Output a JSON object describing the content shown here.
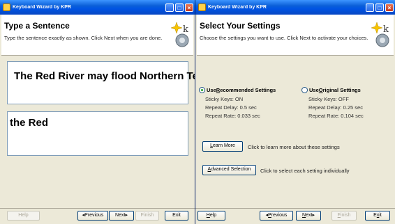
{
  "left": {
    "title": "Keyboard Wizard by KPR",
    "heading": "Type a Sentence",
    "subheading": "Type the sentence exactly as shown. Click Next when you are done.",
    "target_sentence": "The Red River may flood Northern Texas!",
    "typed_text": "the Red",
    "buttons": {
      "help": "Help",
      "previous": "Previous",
      "next": "Next",
      "finish": "Finish",
      "exit": "Exit"
    }
  },
  "right": {
    "title": "Keyboard Wizard by KPR",
    "heading": "Select Your Settings",
    "subheading": "Choose the settings you want to use. Click Next to activate your choices.",
    "options": [
      {
        "label_u": "R",
        "label_rest": "ecommended Settings",
        "prefix": "Use ",
        "selected": true,
        "settings": [
          "Sticky Keys: ON",
          "Repeat Delay: 0.5 sec",
          "Repeat Rate: 0.033 sec"
        ]
      },
      {
        "label_u": "O",
        "label_rest": "riginal Settings",
        "prefix": "Use ",
        "selected": false,
        "settings": [
          "Sticky Keys: OFF",
          "Repeat Delay: 0.25 sec",
          "Repeat Rate: 0.104 sec"
        ]
      }
    ],
    "learn_more": {
      "label_u": "L",
      "label_rest": "earn More",
      "desc": "Click to learn more about these settings"
    },
    "advanced": {
      "label_u": "A",
      "label_rest": "dvanced Selection",
      "desc": "Click to select each setting individually"
    },
    "buttons": {
      "help_u": "H",
      "help_rest": "elp",
      "previous_u": "P",
      "previous_rest": "revious",
      "next_u": "N",
      "next_rest": "ext",
      "finish_u": "F",
      "finish_rest": "inish",
      "exit_u": "x",
      "exit_pre": "E",
      "exit_rest": "it"
    }
  },
  "colors": {
    "titlebar": "#0054e3",
    "window": "#ece9d8",
    "header": "#ffffff",
    "radio_dot": "#21a121"
  },
  "icons": [
    "app-icon",
    "minimize-icon",
    "maximize-icon",
    "close-icon",
    "wizard-icon",
    "triangle-left-icon",
    "triangle-right-icon"
  ]
}
